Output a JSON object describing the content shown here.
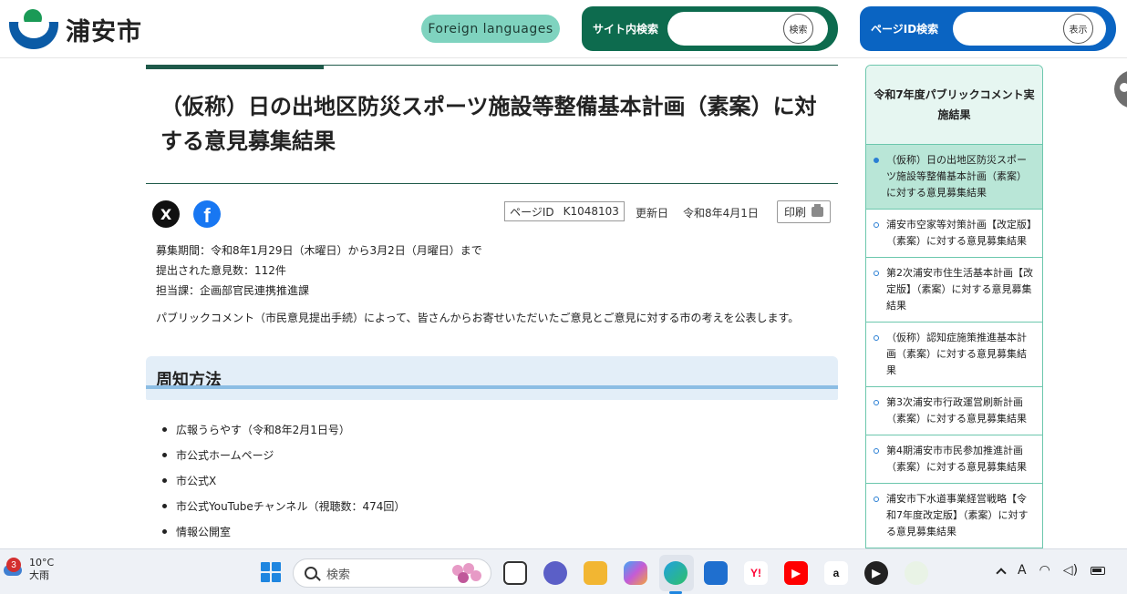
{
  "header": {
    "logo_text": "浦安市",
    "foreign_languages": "Foreign languages",
    "site_search": {
      "label": "サイト内検索",
      "button": "検索",
      "placeholder": ""
    },
    "pageid_search": {
      "label": "ページID検索",
      "button": "表示",
      "placeholder": ""
    }
  },
  "article": {
    "title": "（仮称）日の出地区防災スポーツ施設等整備基本計画（素案）に対する意見募集結果",
    "social": {
      "x": "X",
      "facebook": "f"
    },
    "page_id_label": "ページID",
    "page_id_value": "K1048103",
    "updated_label": "更新日",
    "updated_value": "令和8年4月1日",
    "print_label": "印刷",
    "info": [
      "募集期間：令和8年1月29日（木曜日）から3月2日（月曜日）まで",
      "提出された意見数：112件",
      "担当課：企画部官民連携推進課"
    ],
    "intro": "パブリックコメント（市民意見提出手続）によって、皆さんからお寄せいただいたご意見とご意見に対する市の考えを公表します。",
    "section_title": "周知方法",
    "methods": [
      "広報うらやす（令和8年2月1日号）",
      "市公式ホームページ",
      "市公式X",
      "市公式YouTubeチャンネル（視聴数：474回）",
      "情報公開室"
    ]
  },
  "sidebar": {
    "heading": "令和7年度パブリックコメント実施結果",
    "items": [
      "（仮称）日の出地区防災スポーツ施設等整備基本計画（素案）に対する意見募集結果",
      "浦安市空家等対策計画【改定版】（素案）に対する意見募集結果",
      "第2次浦安市住生活基本計画【改定版】（素案）に対する意見募集結果",
      "（仮称）認知症施策推進基本計画（素案）に対する意見募集結果",
      "第3次浦安市行政運営刷新計画（素案）に対する意見募集結果",
      "第4期浦安市市民参加推進計画（素案）に対する意見募集結果",
      "浦安市下水道事業経営戦略【令和7年度改定版】（素案）に対する意見募集結果"
    ]
  },
  "taskbar": {
    "notification_count": "3",
    "temperature": "10°C",
    "weather": "大雨",
    "search_placeholder": "検索",
    "tray_ime": "A"
  },
  "colors": {
    "brand_green": "#0d6b4e",
    "brand_blue": "#0a64c2",
    "foreign_btn": "#7fd3bf",
    "sidebar_active": "#b9e6d7"
  }
}
